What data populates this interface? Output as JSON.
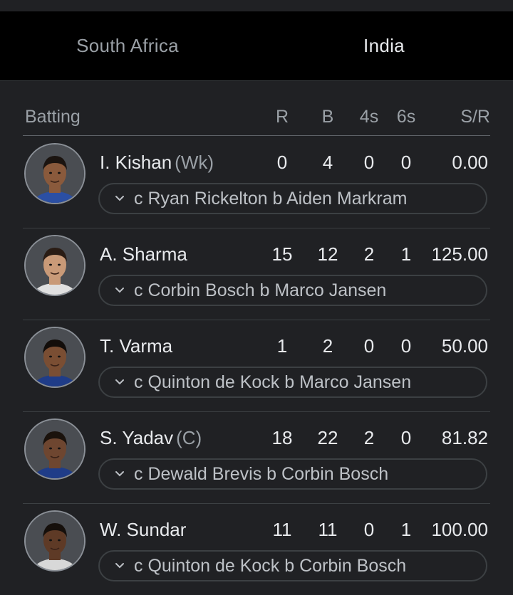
{
  "tabs": [
    {
      "label": "South Africa",
      "selected": false
    },
    {
      "label": "India",
      "selected": true
    }
  ],
  "table": {
    "columns": {
      "batting": "Batting",
      "r": "R",
      "b": "B",
      "fours": "4s",
      "sixes": "6s",
      "sr": "S/R"
    },
    "rows": [
      {
        "name": "I. Kishan",
        "role": "(Wk)",
        "r": "0",
        "b": "4",
        "fours": "0",
        "sixes": "0",
        "sr": "0.00",
        "dismissal": "c Ryan Rickelton b Aiden Markram"
      },
      {
        "name": "A. Sharma",
        "role": "",
        "r": "15",
        "b": "12",
        "fours": "2",
        "sixes": "1",
        "sr": "125.00",
        "dismissal": "c Corbin Bosch b Marco Jansen"
      },
      {
        "name": "T. Varma",
        "role": "",
        "r": "1",
        "b": "2",
        "fours": "0",
        "sixes": "0",
        "sr": "50.00",
        "dismissal": "c Quinton de Kock b Marco Jansen"
      },
      {
        "name": "S. Yadav",
        "role": "(C)",
        "r": "18",
        "b": "22",
        "fours": "2",
        "sixes": "0",
        "sr": "81.82",
        "dismissal": "c Dewald Brevis b Corbin Bosch"
      },
      {
        "name": "W. Sundar",
        "role": "",
        "r": "11",
        "b": "11",
        "fours": "0",
        "sixes": "1",
        "sr": "100.00",
        "dismissal": "c Quinton de Kock b Corbin Bosch"
      }
    ]
  },
  "icons": {
    "expand": "chevron-down-icon",
    "avatar": "player-avatar"
  },
  "colors": {
    "background": "#202124",
    "tab_bar": "#000000",
    "indicator": "#e8eaed",
    "muted_text": "#9aa0a6"
  }
}
